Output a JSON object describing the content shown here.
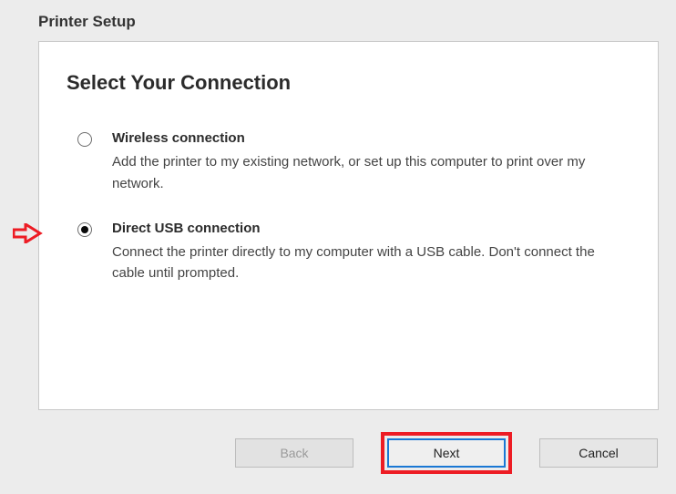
{
  "window_title": "Printer Setup",
  "heading": "Select Your Connection",
  "options": [
    {
      "title": "Wireless connection",
      "desc": "Add the printer to my existing network, or set up this computer to print over my network.",
      "selected": false
    },
    {
      "title": "Direct USB connection",
      "desc": "Connect the printer directly to my computer with a USB cable. Don't connect the cable until prompted.",
      "selected": true
    }
  ],
  "buttons": {
    "back": "Back",
    "next": "Next",
    "cancel": "Cancel"
  },
  "annotations": {
    "arrow_target": "direct-usb-radio",
    "highlight_target": "next-button"
  }
}
